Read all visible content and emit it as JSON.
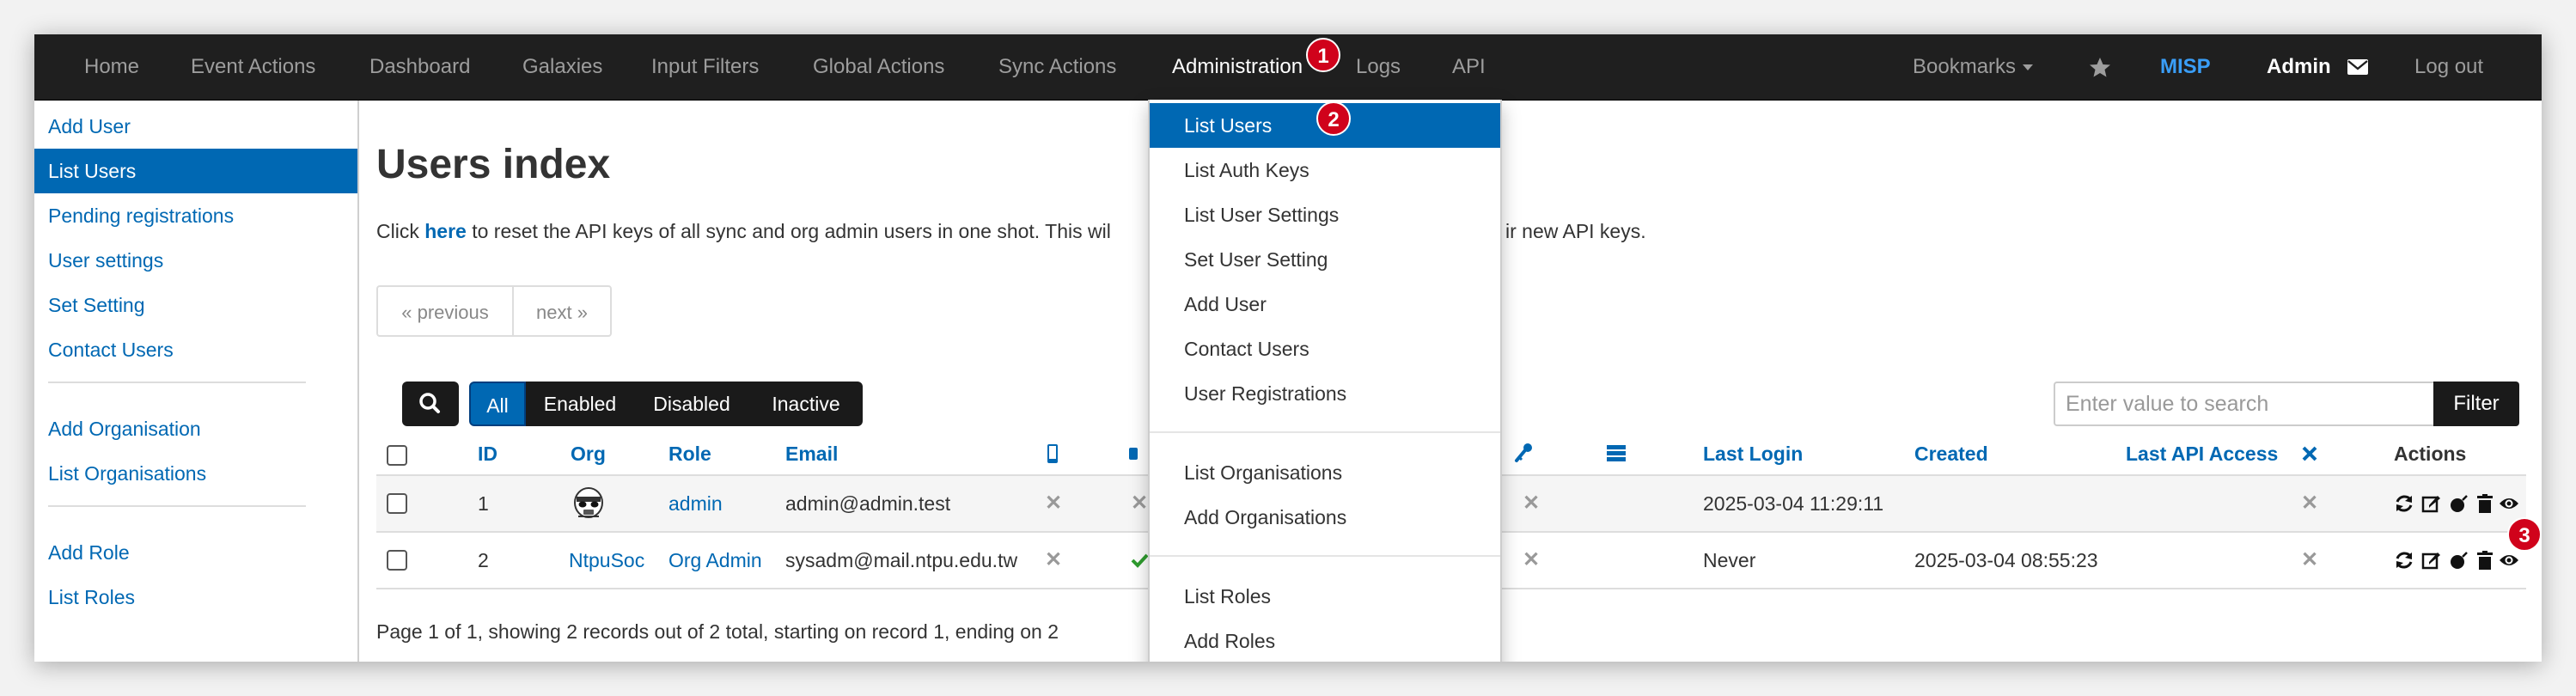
{
  "navbar": {
    "items": [
      "Home",
      "Event Actions",
      "Dashboard",
      "Galaxies",
      "Input Filters",
      "Global Actions",
      "Sync Actions",
      "Administration",
      "Logs",
      "API"
    ],
    "bookmarks": "Bookmarks",
    "brand": "MISP",
    "user": "Admin",
    "logout": "Log out"
  },
  "badges": [
    "1",
    "2",
    "3"
  ],
  "sidebar": {
    "items": [
      "Add User",
      "List Users",
      "Pending registrations",
      "User settings",
      "Set Setting",
      "Contact Users",
      "Add Organisation",
      "List Organisations",
      "Add Role",
      "List Roles"
    ]
  },
  "main": {
    "title": "Users index",
    "notice_pre": "Click ",
    "notice_link": "here",
    "notice_post": " to reset the API keys of all sync and org admin users in one shot. This wil",
    "notice_tail": "ir new API keys.",
    "pager": {
      "prev": "« previous",
      "next": "next »"
    },
    "filters": [
      "All",
      "Enabled",
      "Disabled",
      "Inactive"
    ],
    "search_placeholder": "Enter value to search",
    "filter_button": "Filter",
    "columns": {
      "id": "ID",
      "org": "Org",
      "role": "Role",
      "email": "Email",
      "last_login": "Last Login",
      "created": "Created",
      "last_api": "Last API Access",
      "actions": "Actions"
    },
    "rows": [
      {
        "id": "1",
        "org": "",
        "role": "admin",
        "email": "admin@admin.test",
        "last_login": "2025-03-04 11:29:11",
        "created": ""
      },
      {
        "id": "2",
        "org": "NtpuSoc",
        "role": "Org Admin",
        "email": "sysadm@mail.ntpu.edu.tw",
        "last_login": "Never",
        "created": "2025-03-04 08:55:23"
      }
    ],
    "footer": "Page 1 of 1, showing 2 records out of 2 total, starting on record 1, ending on 2"
  },
  "dropdown": {
    "items": [
      "List Users",
      "List Auth Keys",
      "List User Settings",
      "Set User Setting",
      "Add User",
      "Contact Users",
      "User Registrations",
      "List Organisations",
      "Add Organisations",
      "List Roles",
      "Add Roles"
    ]
  },
  "colors": {
    "navbar": "#1f1f1f",
    "accent": "#0068b3",
    "brand": "#3a9ef7",
    "badge": "#d0021b"
  },
  "icons": [
    "search-icon",
    "star-icon",
    "envelope-icon",
    "refresh-icon",
    "edit-icon",
    "bomb-icon",
    "trash-icon",
    "eye-icon",
    "phone-icon",
    "key-icon",
    "list-icon",
    "close-icon",
    "check-icon",
    "stormtrooper-avatar"
  ]
}
